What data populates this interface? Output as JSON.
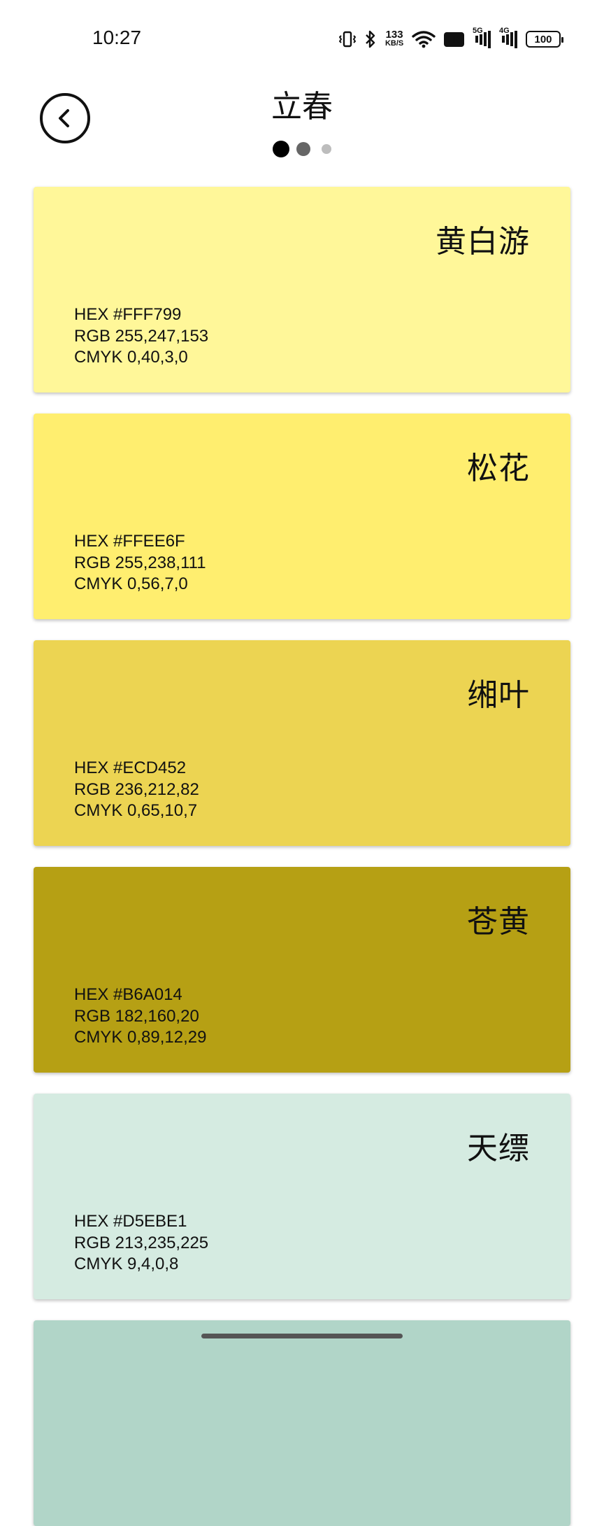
{
  "status_bar": {
    "time": "10:27",
    "net_speed": "133",
    "net_unit": "KB/S",
    "hd": "HD",
    "sim1": "5G",
    "sim2": "4G",
    "battery": "100",
    "icons": [
      "vibrate-icon",
      "bluetooth-icon",
      "wifi-icon",
      "hd-icon",
      "signal-5g-icon",
      "signal-4g-icon",
      "battery-icon"
    ]
  },
  "header": {
    "title": "立春",
    "back_icon": "chevron-left-icon",
    "pages": 3,
    "active_page": 1
  },
  "colors": [
    {
      "name": "黄白游",
      "hex": "HEX #FFF799",
      "rgb": "RGB 255,247,153",
      "cmyk": "CMYK 0,40,3,0",
      "bg": "#FFF799"
    },
    {
      "name": "松花",
      "hex": "HEX #FFEE6F",
      "rgb": "RGB 255,238,111",
      "cmyk": "CMYK 0,56,7,0",
      "bg": "#FFEE6F"
    },
    {
      "name": "缃叶",
      "hex": "HEX #ECD452",
      "rgb": "RGB 236,212,82",
      "cmyk": "CMYK 0,65,10,7",
      "bg": "#ECD452"
    },
    {
      "name": "苍黄",
      "hex": "HEX #B6A014",
      "rgb": "RGB 182,160,20",
      "cmyk": "CMYK 0,89,12,29",
      "bg": "#B6A014"
    },
    {
      "name": "天缥",
      "hex": "HEX #D5EBE1",
      "rgb": "RGB 213,235,225",
      "cmyk": "CMYK 9,4,0,8",
      "bg": "#D5EBE1"
    }
  ],
  "next_card_color": "#B1D5C8"
}
